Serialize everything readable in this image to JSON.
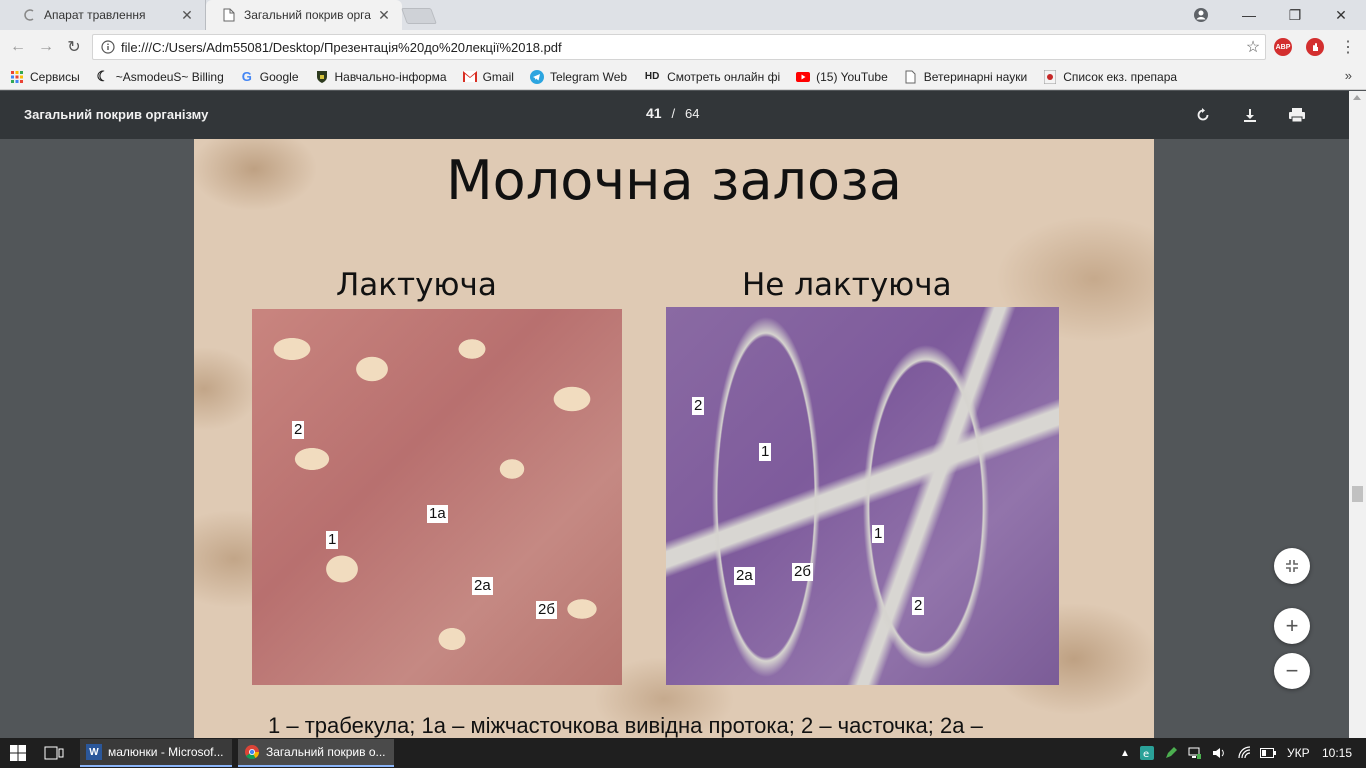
{
  "browser": {
    "tabs": [
      {
        "title": "Апарат травлення",
        "active": false
      },
      {
        "title": "Загальний покрив орга",
        "active": true
      }
    ],
    "url": "file:///C:/Users/Adm55081/Desktop/Презентація%20до%20лекції%2018.pdf",
    "extensions": [
      "ABP",
      "adblock-icon"
    ],
    "bookmarks": [
      {
        "label": "Сервисы",
        "icon": "apps-icon"
      },
      {
        "label": "~AsmodeuS~ Billing",
        "icon": "c-logo-icon"
      },
      {
        "label": "Google",
        "icon": "google-icon"
      },
      {
        "label": "Навчально-інформа",
        "icon": "shield-logo-icon"
      },
      {
        "label": "Gmail",
        "icon": "gmail-icon"
      },
      {
        "label": "Telegram Web",
        "icon": "telegram-icon"
      },
      {
        "label": "Смотреть онлайн фі",
        "icon": "hd-icon"
      },
      {
        "label": "(15) YouTube",
        "icon": "youtube-icon"
      },
      {
        "label": "Ветеринарні науки",
        "icon": "page-icon"
      },
      {
        "label": "Список екз. препара",
        "icon": "doc-icon"
      }
    ],
    "hd_text": "HD"
  },
  "pdf": {
    "title": "Загальний покрив організму",
    "current_page": "41",
    "separator": "/",
    "total_pages": "64"
  },
  "slide": {
    "title": "Молочна залоза",
    "left_subtitle": "Лактуюча",
    "right_subtitle": "Не лактуюча",
    "left_labels": [
      "2",
      "1а",
      "1",
      "2а",
      "2б"
    ],
    "right_labels": [
      "2",
      "1",
      "1",
      "2а",
      "2б",
      "2"
    ],
    "caption": "1 – трабекула; 1а – міжчасточкова вивідна протока; 2 – часточка; 2а –"
  },
  "taskbar": {
    "tasks": [
      {
        "label": "малюнки - Microsof...",
        "icon": "word-icon"
      },
      {
        "label": "Загальний покрив о...",
        "icon": "chrome-icon"
      }
    ],
    "language": "УКР",
    "time": "10:15"
  }
}
